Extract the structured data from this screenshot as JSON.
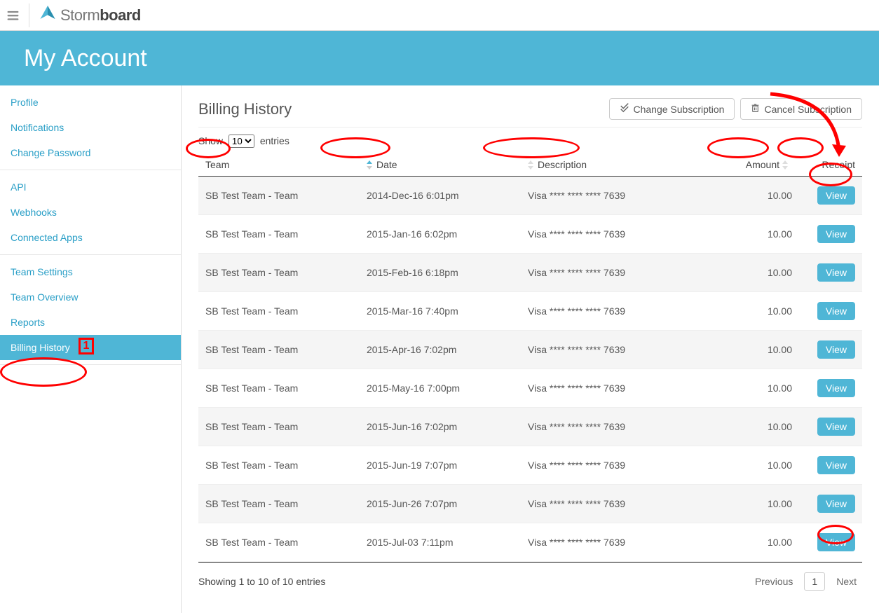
{
  "brand": {
    "storm": "Storm",
    "board": "board"
  },
  "banner_title": "My Account",
  "sidebar": {
    "groups": [
      {
        "items": [
          {
            "label": "Profile",
            "active": false
          },
          {
            "label": "Notifications",
            "active": false
          },
          {
            "label": "Change Password",
            "active": false
          }
        ]
      },
      {
        "items": [
          {
            "label": "API",
            "active": false
          },
          {
            "label": "Webhooks",
            "active": false
          },
          {
            "label": "Connected Apps",
            "active": false
          }
        ]
      },
      {
        "items": [
          {
            "label": "Team Settings",
            "active": false
          },
          {
            "label": "Team Overview",
            "active": false
          },
          {
            "label": "Reports",
            "active": false
          },
          {
            "label": "Billing History",
            "active": true
          }
        ]
      }
    ]
  },
  "content": {
    "title": "Billing History",
    "buttons": {
      "change": "Change Subscription",
      "cancel": "Cancel Subscription"
    },
    "entries": {
      "show": "Show",
      "suffix": "entries",
      "value": "10"
    },
    "columns": {
      "team": "Team",
      "date": "Date",
      "description": "Description",
      "amount": "Amount",
      "receipt": "Receipt"
    },
    "rows": [
      {
        "team": "SB Test Team - Team",
        "date": "2014-Dec-16 6:01pm",
        "description": "Visa **** **** **** 7639",
        "amount": "10.00"
      },
      {
        "team": "SB Test Team - Team",
        "date": "2015-Jan-16 6:02pm",
        "description": "Visa **** **** **** 7639",
        "amount": "10.00"
      },
      {
        "team": "SB Test Team - Team",
        "date": "2015-Feb-16 6:18pm",
        "description": "Visa **** **** **** 7639",
        "amount": "10.00"
      },
      {
        "team": "SB Test Team - Team",
        "date": "2015-Mar-16 7:40pm",
        "description": "Visa **** **** **** 7639",
        "amount": "10.00"
      },
      {
        "team": "SB Test Team - Team",
        "date": "2015-Apr-16 7:02pm",
        "description": "Visa **** **** **** 7639",
        "amount": "10.00"
      },
      {
        "team": "SB Test Team - Team",
        "date": "2015-May-16 7:00pm",
        "description": "Visa **** **** **** 7639",
        "amount": "10.00"
      },
      {
        "team": "SB Test Team - Team",
        "date": "2015-Jun-16 7:02pm",
        "description": "Visa **** **** **** 7639",
        "amount": "10.00"
      },
      {
        "team": "SB Test Team - Team",
        "date": "2015-Jun-19 7:07pm",
        "description": "Visa **** **** **** 7639",
        "amount": "10.00"
      },
      {
        "team": "SB Test Team - Team",
        "date": "2015-Jun-26 7:07pm",
        "description": "Visa **** **** **** 7639",
        "amount": "10.00"
      },
      {
        "team": "SB Test Team - Team",
        "date": "2015-Jul-03 7:11pm",
        "description": "Visa **** **** **** 7639",
        "amount": "10.00"
      }
    ],
    "view_label": "View",
    "footer": {
      "showing": "Showing 1 to 10 of 10 entries",
      "previous": "Previous",
      "page": "1",
      "next": "Next"
    }
  },
  "annotation": {
    "box1": "1"
  }
}
